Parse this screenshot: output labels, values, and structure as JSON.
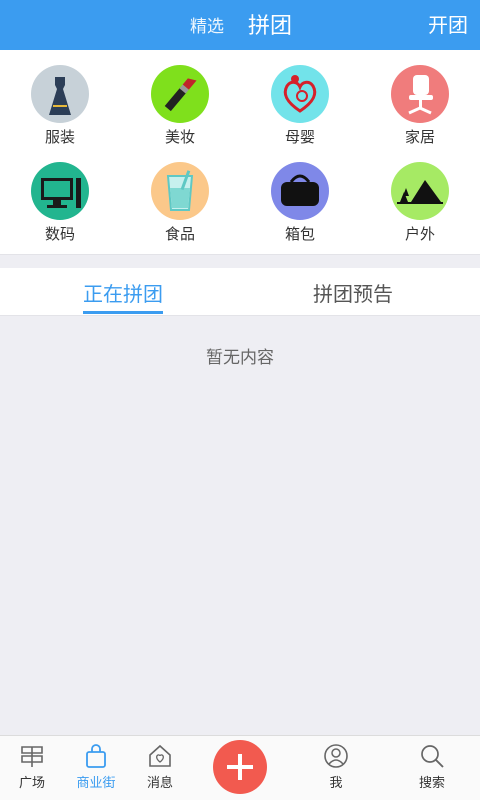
{
  "header": {
    "tab_featured": "精选",
    "tab_group": "拼团",
    "open_group": "开团"
  },
  "categories": [
    {
      "label": "服装",
      "icon": "dress-icon",
      "color": "#c7d1d8"
    },
    {
      "label": "美妆",
      "icon": "lipstick-icon",
      "color": "#7fe01c"
    },
    {
      "label": "母婴",
      "icon": "mother-baby-icon",
      "color": "#72e3ea"
    },
    {
      "label": "家居",
      "icon": "office-chair-icon",
      "color": "#f07c7c"
    },
    {
      "label": "数码",
      "icon": "computer-icon",
      "color": "#22b58f"
    },
    {
      "label": "食品",
      "icon": "drink-glass-icon",
      "color": "#fbc88a"
    },
    {
      "label": "箱包",
      "icon": "handbag-icon",
      "color": "#7f88e8"
    },
    {
      "label": "户外",
      "icon": "tent-icon",
      "color": "#a6ea64"
    }
  ],
  "tabs": {
    "active": "正在拼团",
    "preview": "拼团预告"
  },
  "empty_text": "暂无内容",
  "nav": {
    "square": "广场",
    "mall": "商业街",
    "messages": "消息",
    "me": "我",
    "search": "搜索"
  },
  "colors": {
    "accent": "#3b9cf0",
    "add_button": "#f25a4f"
  }
}
